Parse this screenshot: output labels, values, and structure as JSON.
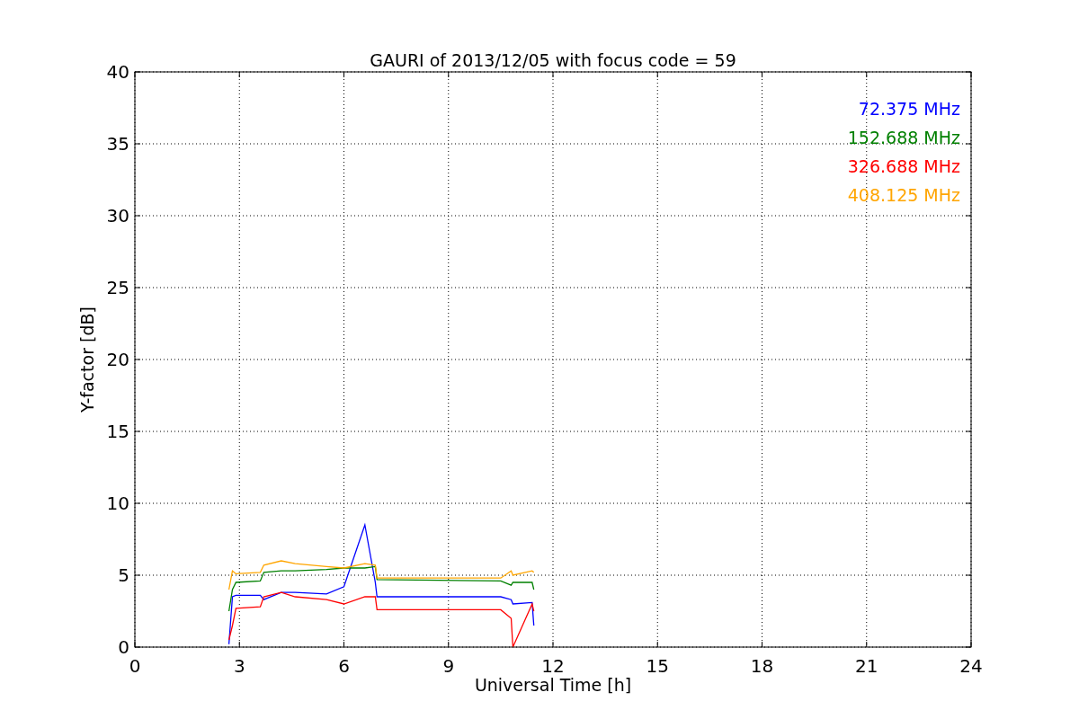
{
  "chart_data": {
    "type": "line",
    "title": "GAURI of 2013/12/05 with focus code = 59",
    "xlabel": "Universal Time [h]",
    "ylabel": "Y-factor [dB]",
    "x": [
      2.7,
      2.8,
      2.9,
      3.6,
      3.7,
      4.2,
      4.6,
      5.5,
      6.0,
      6.6,
      6.9,
      6.95,
      10.5,
      10.8,
      10.85,
      11.4,
      11.45
    ],
    "series": [
      {
        "name": "72.375 MHz",
        "color": "#0000ff",
        "values": [
          0.2,
          3.5,
          3.6,
          3.6,
          3.3,
          3.8,
          3.8,
          3.7,
          4.2,
          8.5,
          4.5,
          3.5,
          3.5,
          3.3,
          3.0,
          3.1,
          1.5
        ]
      },
      {
        "name": "152.688 MHz",
        "color": "#008000",
        "values": [
          2.5,
          4.0,
          4.5,
          4.6,
          5.2,
          5.3,
          5.3,
          5.4,
          5.5,
          5.5,
          5.6,
          4.7,
          4.6,
          4.3,
          4.5,
          4.5,
          4.0
        ]
      },
      {
        "name": "326.688 MHz",
        "color": "#ff0000",
        "values": [
          0.5,
          1.5,
          2.7,
          2.8,
          3.5,
          3.8,
          3.5,
          3.3,
          3.0,
          3.5,
          3.5,
          2.6,
          2.6,
          2.0,
          0.0,
          3.0,
          2.5
        ]
      },
      {
        "name": "408.125 MHz",
        "color": "#ffa500",
        "values": [
          4.0,
          5.3,
          5.1,
          5.2,
          5.7,
          6.0,
          5.8,
          5.6,
          5.5,
          5.8,
          5.7,
          4.8,
          4.8,
          5.3,
          5.0,
          5.3,
          5.2
        ]
      }
    ],
    "grid": true,
    "xlim": [
      0,
      24
    ],
    "ylim": [
      0,
      40
    ],
    "xticks": [
      0,
      3,
      6,
      9,
      12,
      15,
      18,
      21,
      24
    ],
    "yticks": [
      0,
      5,
      10,
      15,
      20,
      25,
      30,
      35,
      40
    ]
  }
}
